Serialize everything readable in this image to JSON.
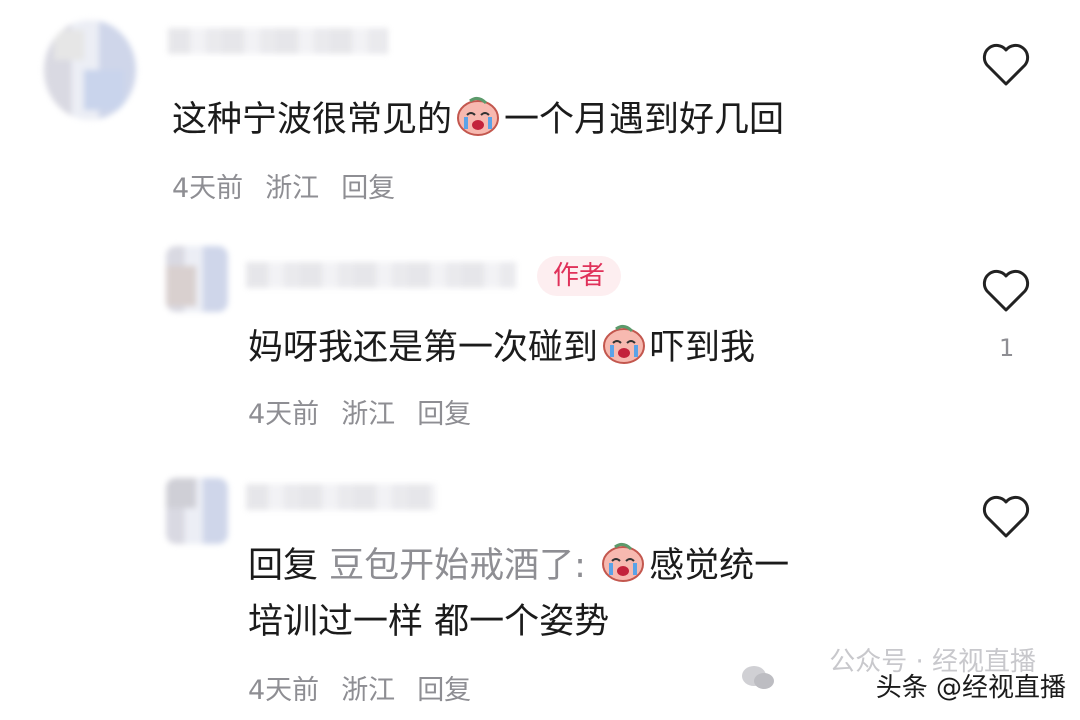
{
  "comments": [
    {
      "text_before": "这种宁波很常见的",
      "text_after": "一个月遇到好几回",
      "time": "4天前",
      "location": "浙江",
      "reply_label": "回复",
      "like_count": ""
    },
    {
      "author_tag": "作者",
      "text_before": "妈呀我还是第一次碰到",
      "text_after": "吓到我",
      "time": "4天前",
      "location": "浙江",
      "reply_label": "回复",
      "like_count": "1"
    },
    {
      "reply_prefix": "回复",
      "quoted_user": "豆包开始戒酒了:",
      "text_line1_after": "感觉统一",
      "text_line2": "培训过一样 都一个姿势",
      "time": "4天前",
      "location": "浙江",
      "reply_label": "回复",
      "like_count": ""
    }
  ],
  "watermark": {
    "faded_text": "公众号 · 经视直播",
    "main_text": "头条 @经视直播"
  },
  "icons": {
    "like": "heart-outline-icon",
    "emoji": "crying-face-emoji",
    "wechat": "wechat-icon"
  },
  "colors": {
    "author_tag_bg": "#fdeef0",
    "author_tag_text": "#e0315a",
    "meta_text": "#8e8e93"
  }
}
